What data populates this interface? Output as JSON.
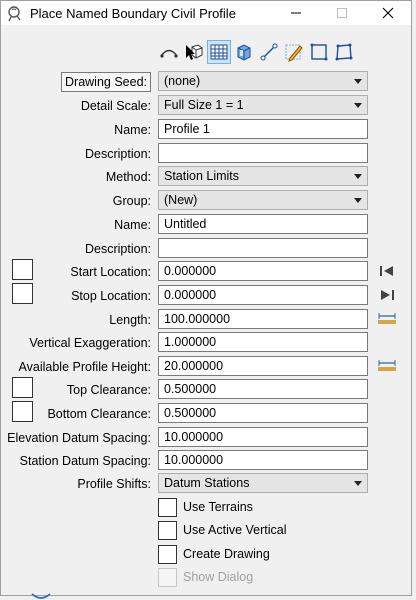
{
  "window": {
    "title": "Place Named Boundary Civil Profile",
    "icon": "civil-profile-app-icon",
    "controls": [
      "minimize-icon",
      "maximize-icon",
      "close-icon"
    ]
  },
  "toolbar": {
    "tools": [
      {
        "name": "tool-civil-profile",
        "icon": "profile-curve-icon"
      },
      {
        "name": "tool-select-element",
        "icon": "cube-cursor-icon"
      },
      {
        "name": "tool-grid",
        "icon": "grid-icon",
        "active": true
      },
      {
        "name": "tool-3d-box",
        "icon": "box-3d-icon"
      },
      {
        "name": "tool-line",
        "icon": "line-icon"
      },
      {
        "name": "tool-pencil",
        "icon": "pencil-icon"
      },
      {
        "name": "tool-square",
        "icon": "square-icon"
      },
      {
        "name": "tool-shape",
        "icon": "shape-icon"
      }
    ]
  },
  "form": {
    "drawing_seed": {
      "label": "Drawing Seed:",
      "value": "(none)"
    },
    "detail_scale": {
      "label": "Detail Scale:",
      "value": "Full Size 1 = 1"
    },
    "name": {
      "label": "Name:",
      "value": "Profile 1"
    },
    "description": {
      "label": "Description:",
      "value": ""
    },
    "method": {
      "label": "Method:",
      "value": "Station Limits"
    },
    "group": {
      "label": "Group:",
      "value": "(New)"
    },
    "group_name": {
      "label": "Name:",
      "value": "Untitled"
    },
    "group_description": {
      "label": "Description:",
      "value": ""
    },
    "start_location": {
      "label": "Start Location:",
      "value": "0.000000"
    },
    "stop_location": {
      "label": "Stop Location:",
      "value": "0.000000"
    },
    "length": {
      "label": "Length:",
      "value": "100.000000"
    },
    "vertical_exaggeration": {
      "label": "Vertical Exaggeration:",
      "value": "1.000000"
    },
    "available_profile_height": {
      "label": "Available Profile Height:",
      "value": "20.000000"
    },
    "top_clearance": {
      "label": "Top Clearance:",
      "value": "0.500000"
    },
    "bottom_clearance": {
      "label": "Bottom Clearance:",
      "value": "0.500000"
    },
    "elevation_datum_spacing": {
      "label": "Elevation Datum Spacing:",
      "value": "10.000000"
    },
    "station_datum_spacing": {
      "label": "Station Datum Spacing:",
      "value": "10.000000"
    },
    "profile_shifts": {
      "label": "Profile Shifts:",
      "value": "Datum Stations"
    }
  },
  "checkboxes": {
    "use_terrains": {
      "label": "Use Terrains",
      "checked": false
    },
    "use_active_vertical": {
      "label": "Use Active Vertical",
      "checked": false
    },
    "create_drawing": {
      "label": "Create Drawing",
      "checked": false
    },
    "show_dialog": {
      "label": "Show Dialog",
      "checked": false,
      "disabled": true
    }
  },
  "colors": {
    "accent": "#cce4f7",
    "ruler": "#d9a441",
    "icon_blue": "#2b6cb0"
  }
}
